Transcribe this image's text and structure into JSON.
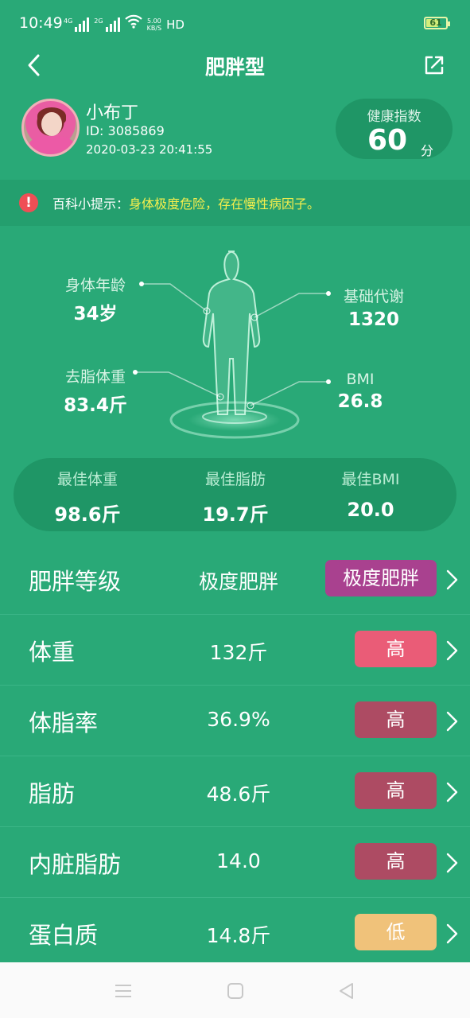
{
  "status_bar": {
    "time": "10:49",
    "signal_1": "4G",
    "signal_2": "2G",
    "speed_value": "5.00",
    "speed_unit": "KB/S",
    "hd": "HD",
    "battery": "61",
    "battery_level": 0.61
  },
  "nav": {
    "title": "肥胖型"
  },
  "profile": {
    "name": "小布丁",
    "id": "ID: 3085869",
    "datetime": "2020-03-23 20:41:55"
  },
  "score": {
    "label": "健康指数",
    "value": "60",
    "unit": "分"
  },
  "tip": {
    "prefix": "百科小提示：",
    "text": "身体极度危险，存在慢性病因子。"
  },
  "body_metrics": {
    "body_age": {
      "label": "身体年龄",
      "value": "34岁"
    },
    "bmr": {
      "label": "基础代谢",
      "value": "1320"
    },
    "lean_mass": {
      "label": "去脂体重",
      "value": "83.4斤"
    },
    "bmi": {
      "label": "BMI",
      "value": "26.8"
    }
  },
  "best": [
    {
      "label": "最佳体重",
      "value": "98.6斤"
    },
    {
      "label": "最佳脂肪",
      "value": "19.7斤"
    },
    {
      "label": "最佳BMI",
      "value": "20.0"
    }
  ],
  "rows": [
    {
      "name": "肥胖等级",
      "value": "极度肥胖",
      "badge": "极度肥胖",
      "badge_color": "#a9418f"
    },
    {
      "name": "体重",
      "value": "132斤",
      "badge": "高",
      "badge_color": "#ea5c77"
    },
    {
      "name": "体脂率",
      "value": "36.9%",
      "badge": "高",
      "badge_color": "#ad4b63"
    },
    {
      "name": "脂肪",
      "value": "48.6斤",
      "badge": "高",
      "badge_color": "#ad4b63"
    },
    {
      "name": "内脏脂肪",
      "value": "14.0",
      "badge": "高",
      "badge_color": "#ad4b63"
    },
    {
      "name": "蛋白质",
      "value": "14.8斤",
      "badge": "低",
      "badge_color": "#f0c27a"
    }
  ],
  "colors": {
    "background": "#29a977",
    "panel": "#1f9666",
    "warning_text": "#f6ef4d",
    "alert_icon": "#ef4e55"
  }
}
